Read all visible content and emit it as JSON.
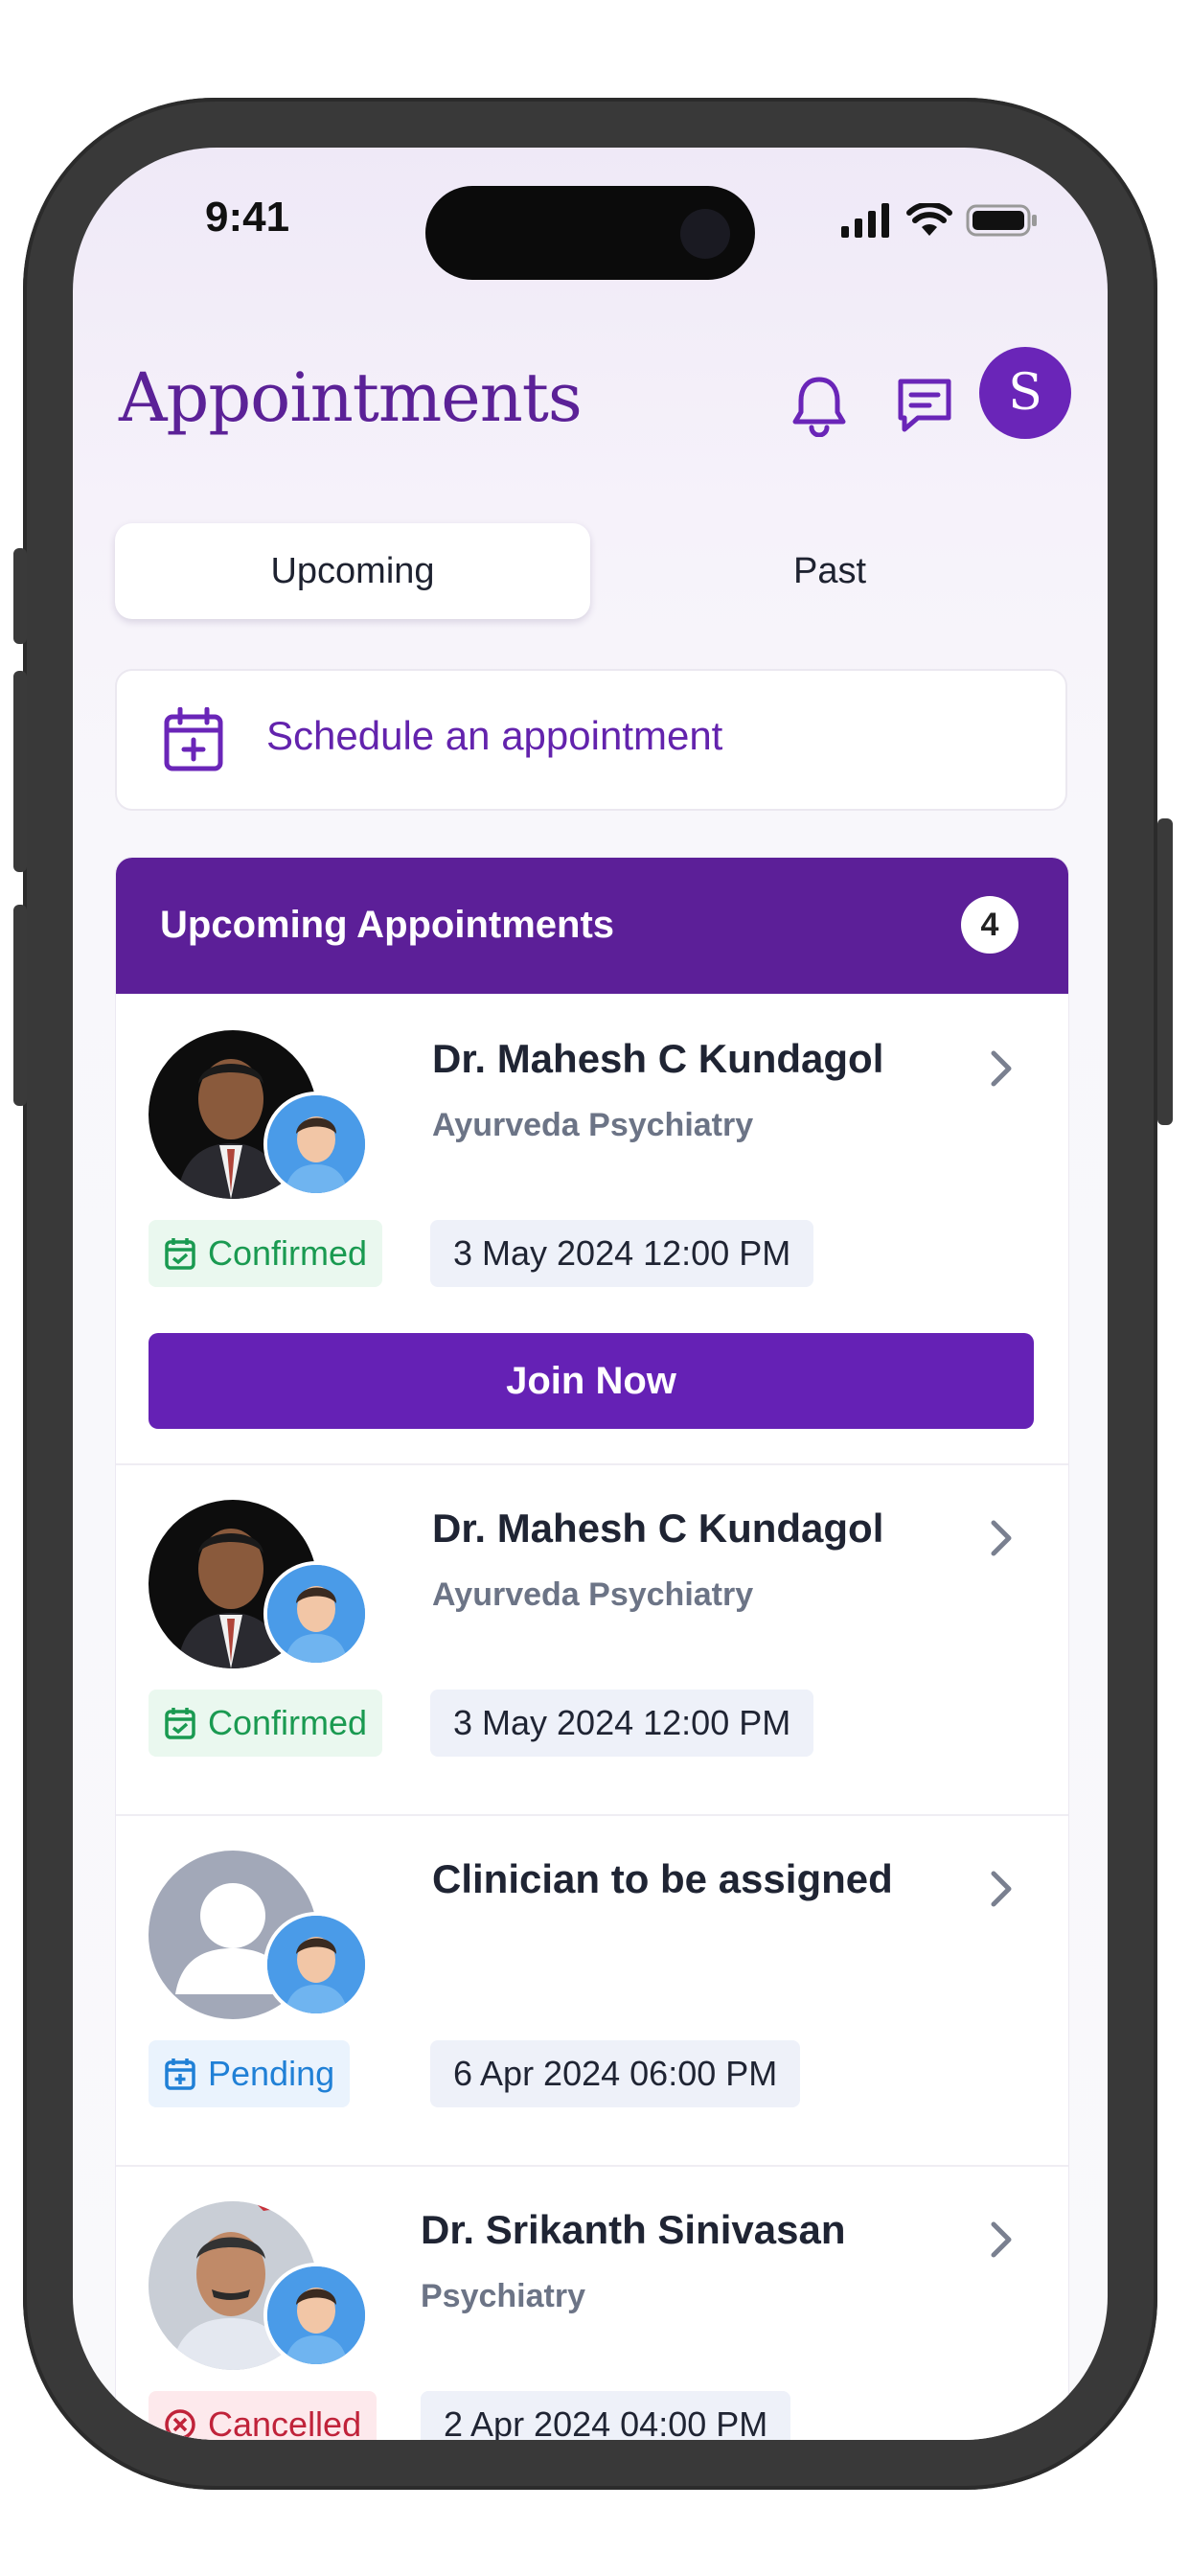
{
  "status_bar": {
    "time": "9:41"
  },
  "header": {
    "title": "Appointments",
    "avatar_initial": "S"
  },
  "tabs": [
    {
      "label": "Upcoming",
      "active": true
    },
    {
      "label": "Past",
      "active": false
    }
  ],
  "schedule": {
    "label": "Schedule an appointment"
  },
  "upcoming": {
    "heading": "Upcoming Appointments",
    "count": "4",
    "join_label": "Join Now",
    "items": [
      {
        "name": "Dr. Mahesh C Kundagol",
        "specialty": "Ayurveda Psychiatry",
        "status": "Confirmed",
        "datetime": "3 May 2024 12:00 PM"
      },
      {
        "name": "Dr. Mahesh C Kundagol",
        "specialty": "Ayurveda Psychiatry",
        "status": "Confirmed",
        "datetime": "3 May 2024 12:00 PM"
      },
      {
        "name": "Clinician to be assigned",
        "specialty": "",
        "status": "Pending",
        "datetime": "6 Apr 2024 06:00 PM"
      },
      {
        "name": "Dr. Srikanth Sinivasan",
        "specialty": "Psychiatry",
        "status": "Cancelled",
        "datetime": "2 Apr 2024 04:00 PM"
      }
    ]
  },
  "colors": {
    "brand": "#5c1f98",
    "accent": "#6521b5",
    "confirmed": "#1a9a51",
    "pending": "#2080d6",
    "cancelled": "#c0233a"
  },
  "icons": [
    "bell-icon",
    "chat-icon",
    "calendar-plus-icon",
    "chevron-right-icon",
    "calendar-check-icon",
    "x-circle-icon",
    "signal-icon",
    "wifi-icon",
    "battery-icon"
  ]
}
